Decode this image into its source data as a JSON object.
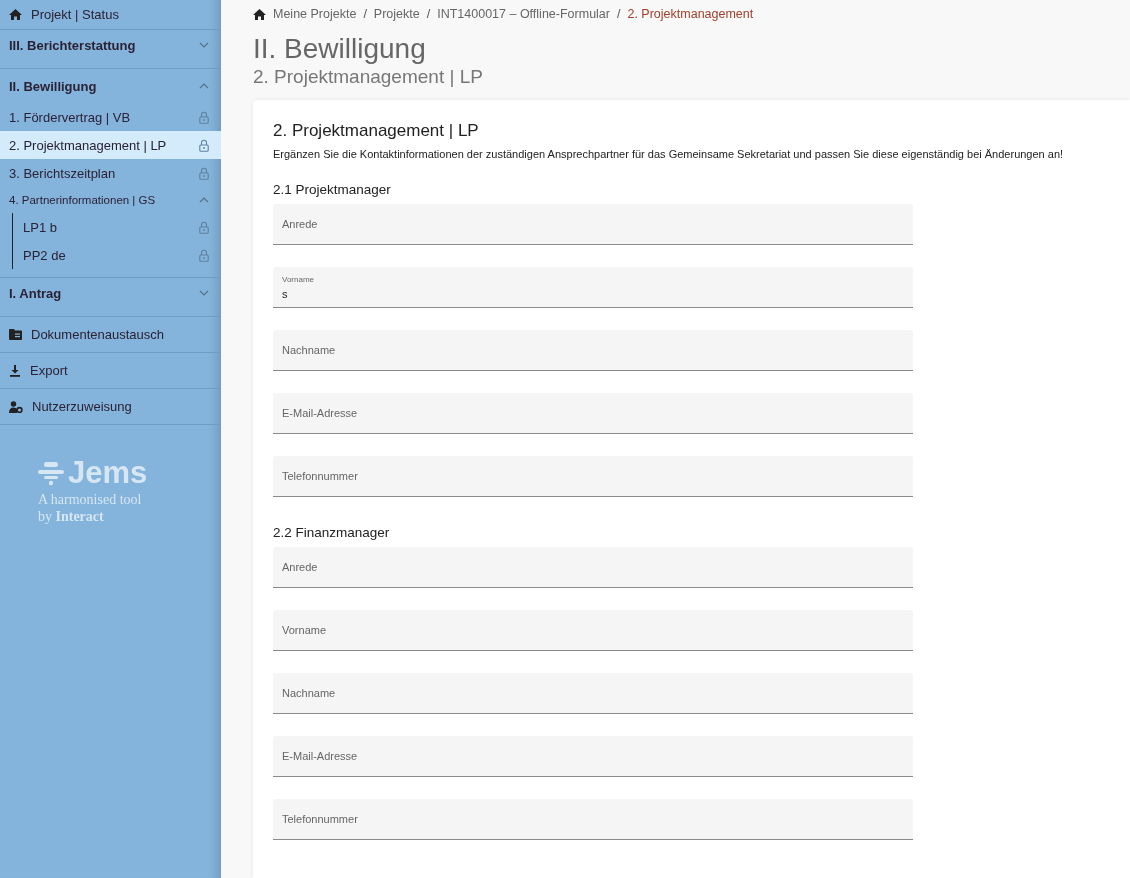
{
  "sidebar": {
    "items": [
      {
        "kind": "home",
        "label": "Projekt | Status"
      },
      {
        "kind": "section",
        "label": "III. Berichterstattung",
        "expanded": false
      },
      {
        "kind": "section",
        "label": "II. Bewilligung",
        "expanded": true,
        "children": [
          {
            "label": "1. Fördervertrag | VB",
            "selected": false,
            "locked": true
          },
          {
            "label": "2. Projektmanagement | LP",
            "selected": true,
            "locked": true
          },
          {
            "label": "3. Berichtszeitplan",
            "selected": false,
            "locked": true
          },
          {
            "label": "4. Partnerinformationen | GS",
            "selected": false,
            "expanded": true,
            "children": [
              {
                "label": "LP1 b",
                "selected": false,
                "locked": true
              },
              {
                "label": "PP2 de",
                "selected": false,
                "locked": true
              }
            ]
          }
        ]
      },
      {
        "kind": "section",
        "label": "I. Antrag",
        "expanded": false
      },
      {
        "kind": "folder",
        "label": "Dokumentenaustausch"
      },
      {
        "kind": "download",
        "label": "Export"
      },
      {
        "kind": "users",
        "label": "Nutzerzuweisung"
      }
    ],
    "logo": {
      "name": "Jems",
      "tagline": "A harmonised tool",
      "byline": "by **Interact**"
    }
  },
  "breadcrumb": {
    "separator": "/",
    "items": [
      {
        "label": "Meine Projekte",
        "current": false
      },
      {
        "label": "Projekte",
        "current": false
      },
      {
        "label": "INT1400017 – Offline-Formular",
        "current": false
      },
      {
        "label": "2. Projektmanagement",
        "current": true
      }
    ]
  },
  "page_title": "II. Bewilligung",
  "page_subtitle": "2. Projektmanagement | LP",
  "card": {
    "title": "2. Projektmanagement | LP",
    "description": "Ergänzen Sie die Kontaktinformationen der zuständigen Ansprechpartner für das Gemeinsame Sekretariat und passen Sie diese eigenständig bei Änderungen an!",
    "sections": [
      {
        "title": "2.1 Projektmanager",
        "fields": [
          {
            "placeholder": "Anrede"
          },
          {
            "label": "Vorname",
            "value": "s"
          },
          {
            "placeholder": "Nachname"
          },
          {
            "placeholder": "E-Mail-Adresse"
          },
          {
            "placeholder": "Telefonnummer"
          }
        ]
      },
      {
        "title": "2.2 Finanzmanager",
        "fields": [
          {
            "placeholder": "Anrede"
          },
          {
            "placeholder": "Vorname"
          },
          {
            "placeholder": "Nachname"
          },
          {
            "placeholder": "E-Mail-Adresse"
          },
          {
            "placeholder": "Telefonnummer"
          }
        ]
      }
    ]
  }
}
